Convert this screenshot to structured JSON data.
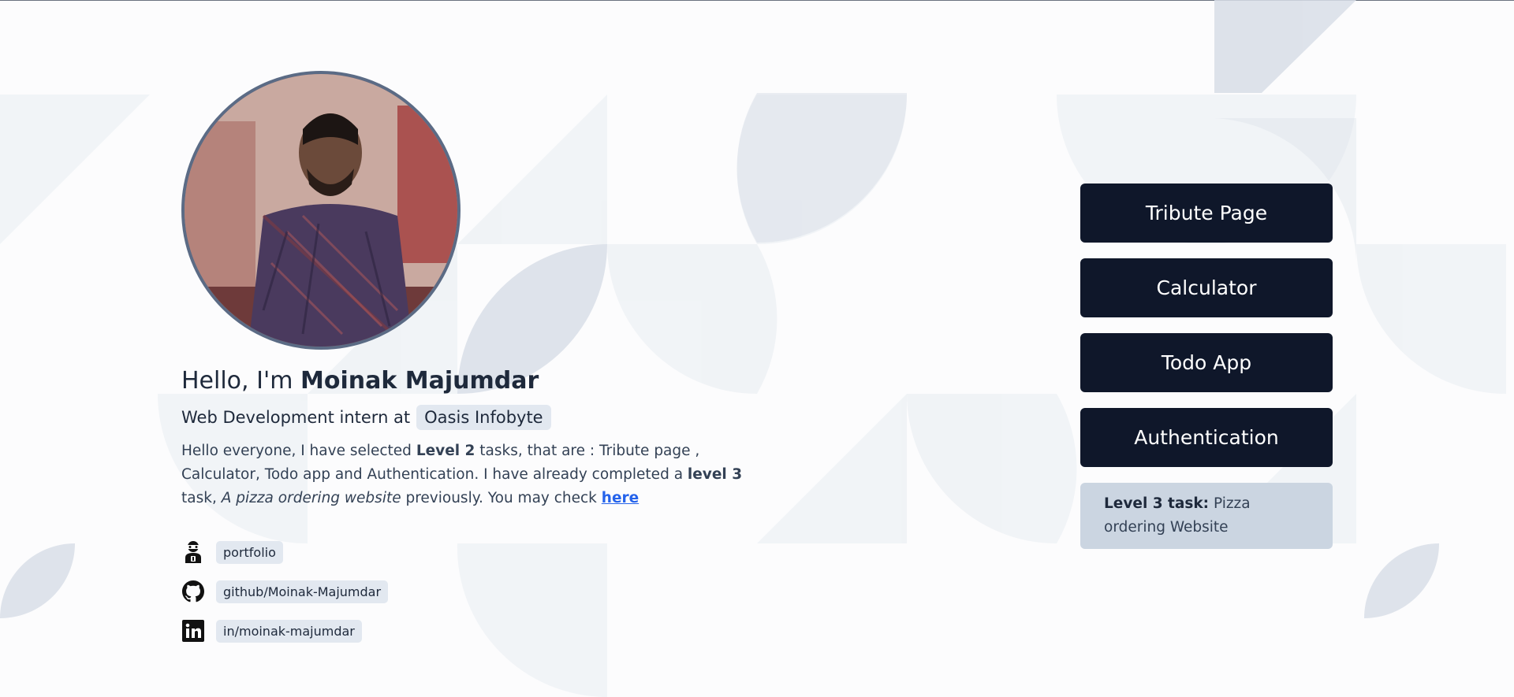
{
  "profile": {
    "greeting_prefix": "Hello, I'm",
    "name": "Moinak Majumdar",
    "role_prefix": "Web Development intern at",
    "company": "Oasis Infobyte",
    "desc": {
      "p1": "Hello everyone, I have selected ",
      "b1": "Level 2",
      "p2": " tasks, that are : Tribute page , Calculator, Todo app and Authentication. I have already completed a ",
      "b2": "level 3",
      "p3": " task, ",
      "i1": "A pizza ordering website",
      "p4": " previously. You may check ",
      "link": "here"
    }
  },
  "links": [
    {
      "icon": "robot-icon",
      "label": "portfolio"
    },
    {
      "icon": "github-icon",
      "label": "github/Moinak-Majumdar"
    },
    {
      "icon": "linkedin-icon",
      "label": "in/moinak-majumdar"
    }
  ],
  "tasks": [
    {
      "label": "Tribute Page"
    },
    {
      "label": "Calculator"
    },
    {
      "label": "Todo App"
    },
    {
      "label": "Authentication"
    }
  ],
  "note": {
    "bold": "Level 3 task:",
    "text": " Pizza ordering Website"
  },
  "colors": {
    "button_bg": "#0f172a",
    "chip_bg": "#e2e8f0",
    "note_bg": "#cbd5e1",
    "link": "#2563eb"
  }
}
